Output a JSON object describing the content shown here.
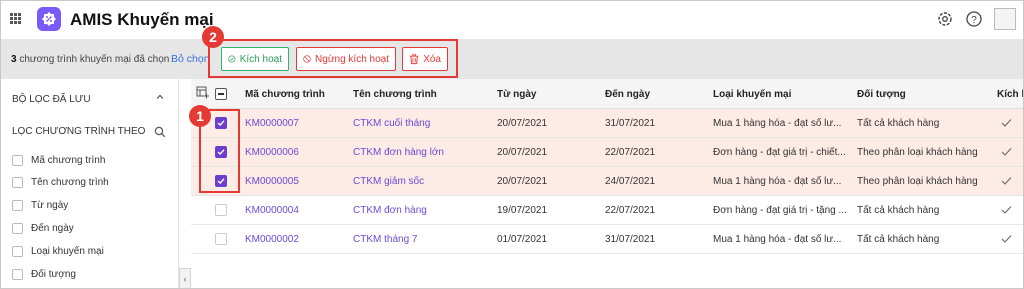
{
  "app": {
    "title": "AMIS Khuyến mại"
  },
  "header": {
    "icons": [
      "apps-grid-icon",
      "gear-icon",
      "help-icon",
      "avatar-image"
    ]
  },
  "toolbar": {
    "selected_count": "3",
    "selected_text": " chương trình khuyến mại đã chọn",
    "unselect_label": "Bỏ chọn",
    "activate_label": "Kích hoạt",
    "stop_label": "Ngừng kích hoạt",
    "delete_label": "Xóa",
    "step2": "2"
  },
  "sidebar": {
    "saved_filters_title": "BỘ LỌC ĐÃ LƯU",
    "filter_by_title": "LỌC CHƯƠNG TRÌNH THEO",
    "filters": [
      "Mã chương trình",
      "Tên chương trình",
      "Từ ngày",
      "Đến ngày",
      "Loại khuyến mại",
      "Đối tượng"
    ],
    "collapse_glyph": "‹"
  },
  "table": {
    "step1": "1",
    "columns": [
      "Mã chương trình",
      "Tên chương trình",
      "Từ ngày",
      "Đến ngày",
      "Loại khuyến mại",
      "Đối tượng",
      "Kích h"
    ],
    "rows": [
      {
        "selected": true,
        "code": "KM0000007",
        "name": "CTKM cuối tháng",
        "from": "20/07/2021",
        "to": "31/07/2021",
        "type": "Mua 1 hàng hóa - đạt số lư...",
        "target": "Tất cả khách hàng"
      },
      {
        "selected": true,
        "code": "KM0000006",
        "name": "CTKM đơn hàng lớn",
        "from": "20/07/2021",
        "to": "22/07/2021",
        "type": "Đơn hàng - đạt giá trị - chiết...",
        "target": "Theo phân loại khách hàng"
      },
      {
        "selected": true,
        "code": "KM0000005",
        "name": "CTKM giảm sốc",
        "from": "20/07/2021",
        "to": "24/07/2021",
        "type": "Mua 1 hàng hóa - đạt số lư...",
        "target": "Theo phân loại khách hàng"
      },
      {
        "selected": false,
        "code": "KM0000004",
        "name": "CTKM đơn hàng",
        "from": "19/07/2021",
        "to": "22/07/2021",
        "type": "Đơn hàng - đạt giá trị - tặng ...",
        "target": "Tất cả khách hàng"
      },
      {
        "selected": false,
        "code": "KM0000002",
        "name": "CTKM tháng 7",
        "from": "01/07/2021",
        "to": "31/07/2021",
        "type": "Mua 1 hàng hóa - đạt số lư...",
        "target": "Tất cả khách hàng"
      }
    ]
  },
  "colors": {
    "accent": "#6a3fd0",
    "annotation": "#e53935",
    "activate": "#2db46a",
    "selected_row": "#fdebe6"
  }
}
